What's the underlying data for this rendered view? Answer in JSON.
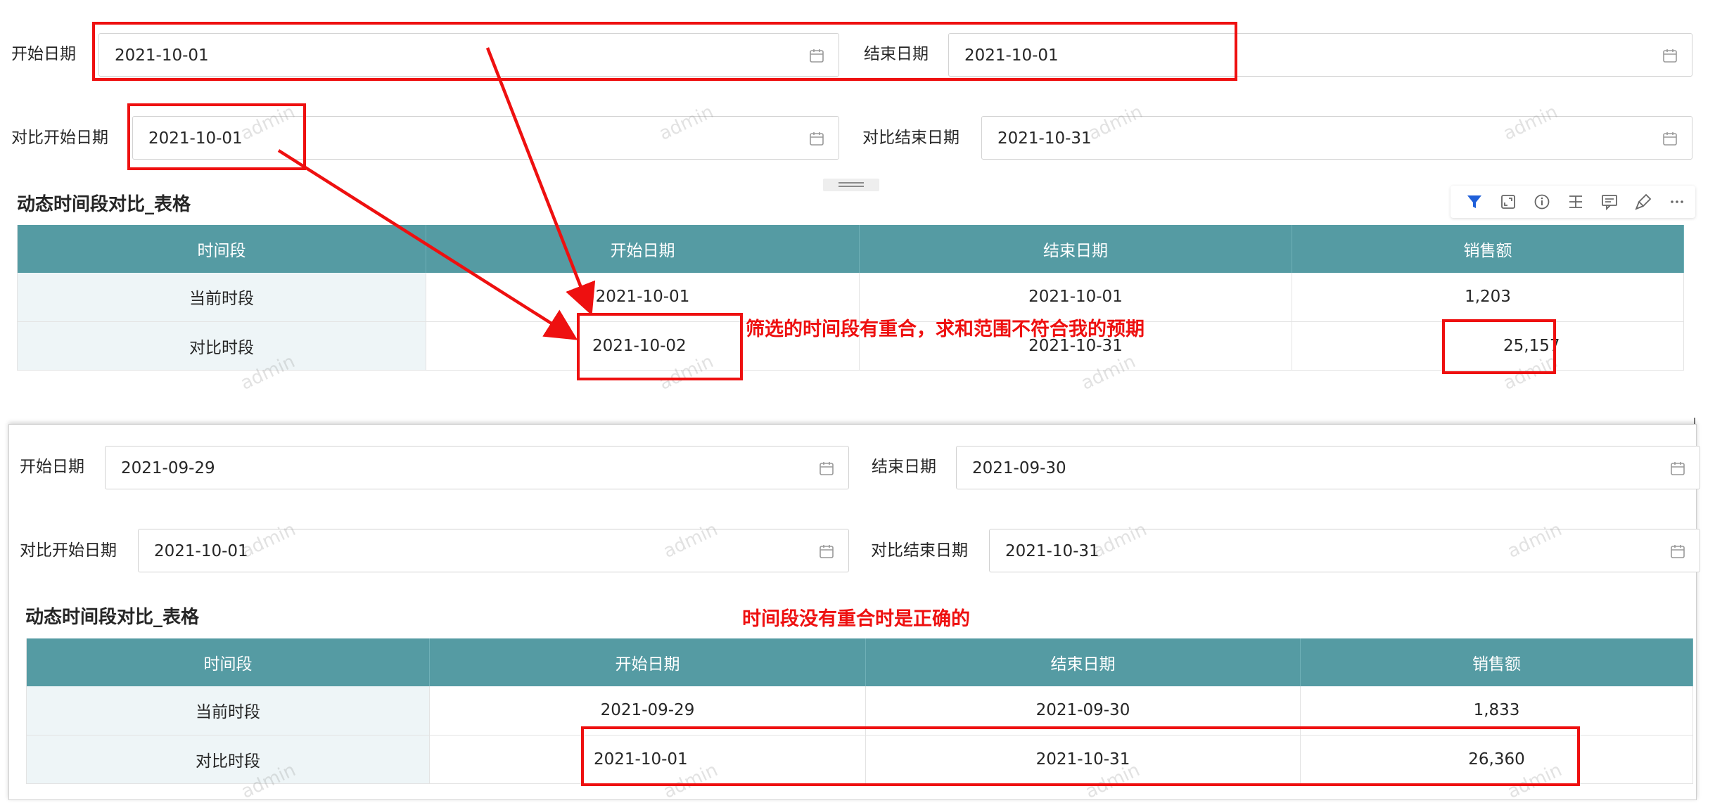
{
  "top": {
    "filters": {
      "start_label": "开始日期",
      "start_value": "2021-10-01",
      "end_label": "结束日期",
      "end_value": "2021-10-01",
      "cmp_start_label": "对比开始日期",
      "cmp_start_value": "2021-10-01",
      "cmp_end_label": "对比结束日期",
      "cmp_end_value": "2021-10-31"
    },
    "table_title": "动态时间段对比_表格",
    "headers": [
      "时间段",
      "开始日期",
      "结束日期",
      "销售额"
    ],
    "rows": [
      [
        "当前时段",
        "2021-10-01",
        "2021-10-01",
        "1,203"
      ],
      [
        "对比时段",
        "2021-10-02",
        "2021-10-31",
        "25,157"
      ]
    ],
    "toolbar_icons": [
      "filter-icon",
      "expand-icon",
      "info-icon",
      "split-icon",
      "comment-icon",
      "brush-icon",
      "more-icon"
    ]
  },
  "bottom": {
    "filters": {
      "start_label": "开始日期",
      "start_value": "2021-09-29",
      "end_label": "结束日期",
      "end_value": "2021-09-30",
      "cmp_start_label": "对比开始日期",
      "cmp_start_value": "2021-10-01",
      "cmp_end_label": "对比结束日期",
      "cmp_end_value": "2021-10-31"
    },
    "table_title": "动态时间段对比_表格",
    "headers": [
      "时间段",
      "开始日期",
      "结束日期",
      "销售额"
    ],
    "rows": [
      [
        "当前时段",
        "2021-09-29",
        "2021-09-30",
        "1,833"
      ],
      [
        "对比时段",
        "2021-10-01",
        "2021-10-31",
        "26,360"
      ]
    ]
  },
  "annotations": {
    "overlap_note": "筛选的时间段有重合，求和范围不符合我的预期",
    "correct_note": "时间段没有重合时是正确的"
  },
  "watermark_text": "admin",
  "colors": {
    "header_bg": "#559ba3",
    "row_head_bg": "#eef5f7",
    "annotation_red": "#ee1010",
    "toolbar_active": "#1f5fd9"
  }
}
